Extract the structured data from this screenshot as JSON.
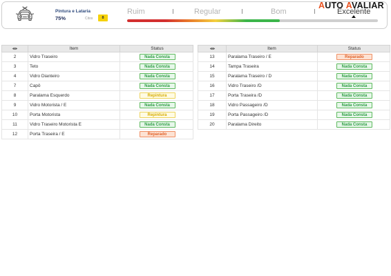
{
  "header": {
    "icon": "car-bodywork-icon",
    "section_title": "Pintura e Lataria",
    "percentage": "75%",
    "count_label": "Citos",
    "count_value": "8",
    "count_badge_color": "#f5d10b"
  },
  "rating": {
    "labels": [
      "Ruim",
      "Regular",
      "Bom",
      "Excelente"
    ],
    "selected_index": 3,
    "bar_level": 0.61,
    "bar_colors": [
      "#d32f2f",
      "#e8782a",
      "#f4d03f",
      "#3bb54a"
    ],
    "track_color": "#cfcfcf"
  },
  "logo": {
    "word_1": "AUTO",
    "word_2": "AVALIAR",
    "accent_color": "#e8501e"
  },
  "status_styles": {
    "ok": {
      "text": "#2f9e44",
      "bg": "#e7f7ea",
      "border": "#5cb85c"
    },
    "repaint": {
      "text": "#d6ac00",
      "bg": "#fffbe3",
      "border": "#ecd35a"
    },
    "repaired": {
      "text": "#e0622a",
      "bg": "#fde2d3",
      "border": "#ef8e62"
    }
  },
  "tables": [
    {
      "header": {
        "icon": "eye-icon",
        "item": "Item",
        "status": "Status"
      },
      "rows": [
        {
          "num": "2",
          "item": "Vidro Traseiro",
          "status": "Nada Consta",
          "status_type": "ok"
        },
        {
          "num": "3",
          "item": "Teto",
          "status": "Nada Consta",
          "status_type": "ok"
        },
        {
          "num": "4",
          "item": "Vidro Dianteiro",
          "status": "Nada Consta",
          "status_type": "ok"
        },
        {
          "num": "7",
          "item": "Capô",
          "status": "Nada Consta",
          "status_type": "ok"
        },
        {
          "num": "8",
          "item": "Paralama Esquerdo",
          "status": "Repintura",
          "status_type": "repaint"
        },
        {
          "num": "9",
          "item": "Vidro Motorista / E",
          "status": "Nada Consta",
          "status_type": "ok"
        },
        {
          "num": "10",
          "item": "Porta Motorista",
          "status": "Repintura",
          "status_type": "repaint"
        },
        {
          "num": "11",
          "item": "Vidro Traseiro Motorista E",
          "status": "Nada Consta",
          "status_type": "ok"
        },
        {
          "num": "12",
          "item": "Porta Traseira / E",
          "status": "Reparado",
          "status_type": "repaired"
        }
      ]
    },
    {
      "header": {
        "icon": "eye-icon",
        "item": "Item",
        "status": "Status"
      },
      "rows": [
        {
          "num": "13",
          "item": "Paralama Traseiro / E",
          "status": "Reparado",
          "status_type": "repaired"
        },
        {
          "num": "14",
          "item": "Tampa Traseira",
          "status": "Nada Consta",
          "status_type": "ok"
        },
        {
          "num": "15",
          "item": "Paralama Traseiro / D",
          "status": "Nada Consta",
          "status_type": "ok"
        },
        {
          "num": "16",
          "item": "Vidro Traseiro /D",
          "status": "Nada Consta",
          "status_type": "ok"
        },
        {
          "num": "17",
          "item": "Porta Traseira /D",
          "status": "Nada Consta",
          "status_type": "ok"
        },
        {
          "num": "18",
          "item": "Vidro Passageiro /D",
          "status": "Nada Consta",
          "status_type": "ok"
        },
        {
          "num": "19",
          "item": "Porta Passageiro /D",
          "status": "Nada Consta",
          "status_type": "ok"
        },
        {
          "num": "20",
          "item": "Paralama Direito",
          "status": "Nada Consta",
          "status_type": "ok"
        }
      ]
    }
  ]
}
